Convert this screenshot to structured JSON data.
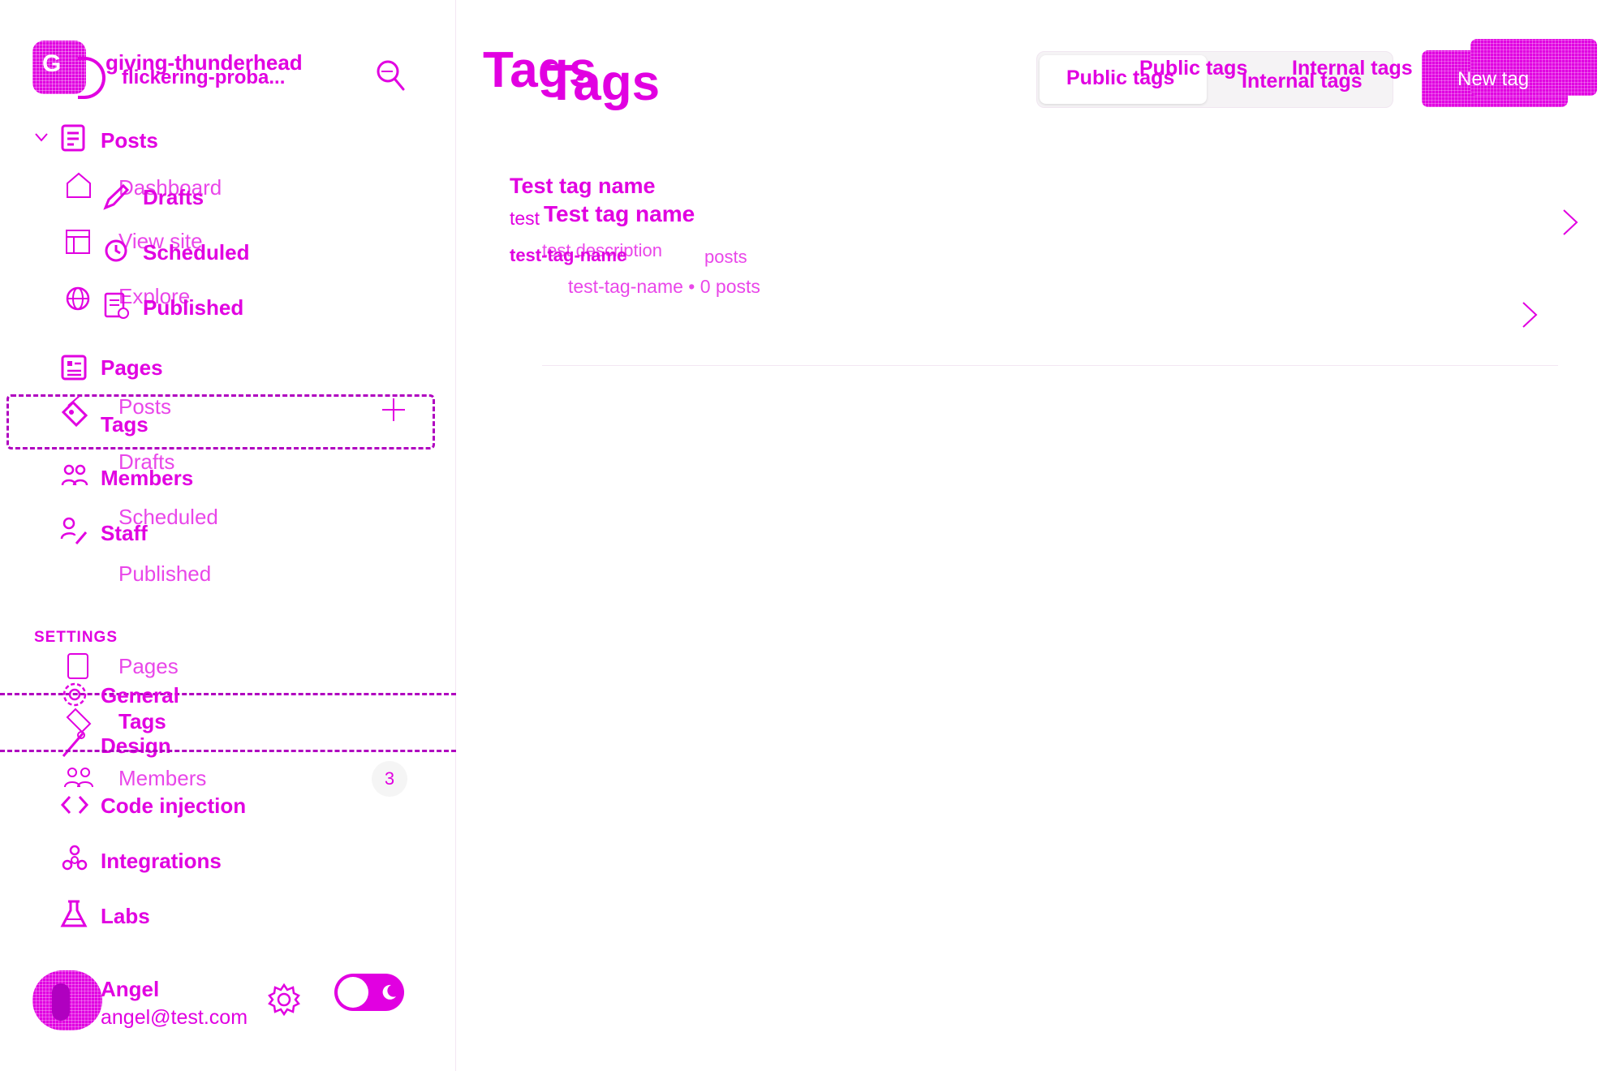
{
  "sidebar": {
    "site_name": "giving-thunderhead",
    "site_name_alt": "flickering-proba...",
    "logo_letter": "G",
    "nav": {
      "posts": "Posts",
      "pages": "Pages",
      "tags": "Tags",
      "members": "Members",
      "staff": "Staff"
    },
    "posts_sub": {
      "drafts": "Drafts",
      "scheduled": "Scheduled",
      "published": "Published"
    },
    "ghost_nav": {
      "dashboard": "Dashboard",
      "view_site": "View site",
      "explore": "Explore",
      "posts": "Posts",
      "drafts": "Drafts",
      "scheduled": "Scheduled",
      "published": "Published",
      "pages": "Pages",
      "tags": "Tags",
      "members": "Members",
      "members_count": "3"
    },
    "settings_heading": "SETTINGS",
    "settings": {
      "general": "General",
      "design": "Design",
      "code_injection": "Code injection",
      "integrations": "Integrations",
      "labs": "Labs"
    },
    "user": {
      "name": "Angel",
      "email": "angel@test.com"
    }
  },
  "main": {
    "title": "Tags",
    "title_alt": "Tags",
    "tabs": {
      "public": "Public tags",
      "internal": "Internal tags",
      "public_alt": "Public tags",
      "internal_alt": "Internal tags"
    },
    "new_button": "New tag",
    "tags": [
      {
        "name": "Test tag name",
        "slug_line": "test",
        "meta": "test-tag-name",
        "name_alt": "Test tag name",
        "description": "test description",
        "posts": "posts",
        "slug_meta": "test-tag-name • 0 posts"
      }
    ]
  },
  "colors": {
    "accent": "#e100e1",
    "accent_dark": "#b000c0",
    "border": "#f3e6f3"
  },
  "icons": [
    "search-icon",
    "chevron-down-icon",
    "posts-icon",
    "home-icon",
    "view-site-icon",
    "globe-icon",
    "pencil-icon",
    "clock-icon",
    "published-icon",
    "pages-icon",
    "tag-icon",
    "plus-icon",
    "members-icon",
    "staff-icon",
    "settings-gear-icon",
    "design-icon",
    "code-icon",
    "integrations-icon",
    "labs-icon",
    "gear-icon",
    "moon-icon",
    "chevron-right-icon"
  ]
}
